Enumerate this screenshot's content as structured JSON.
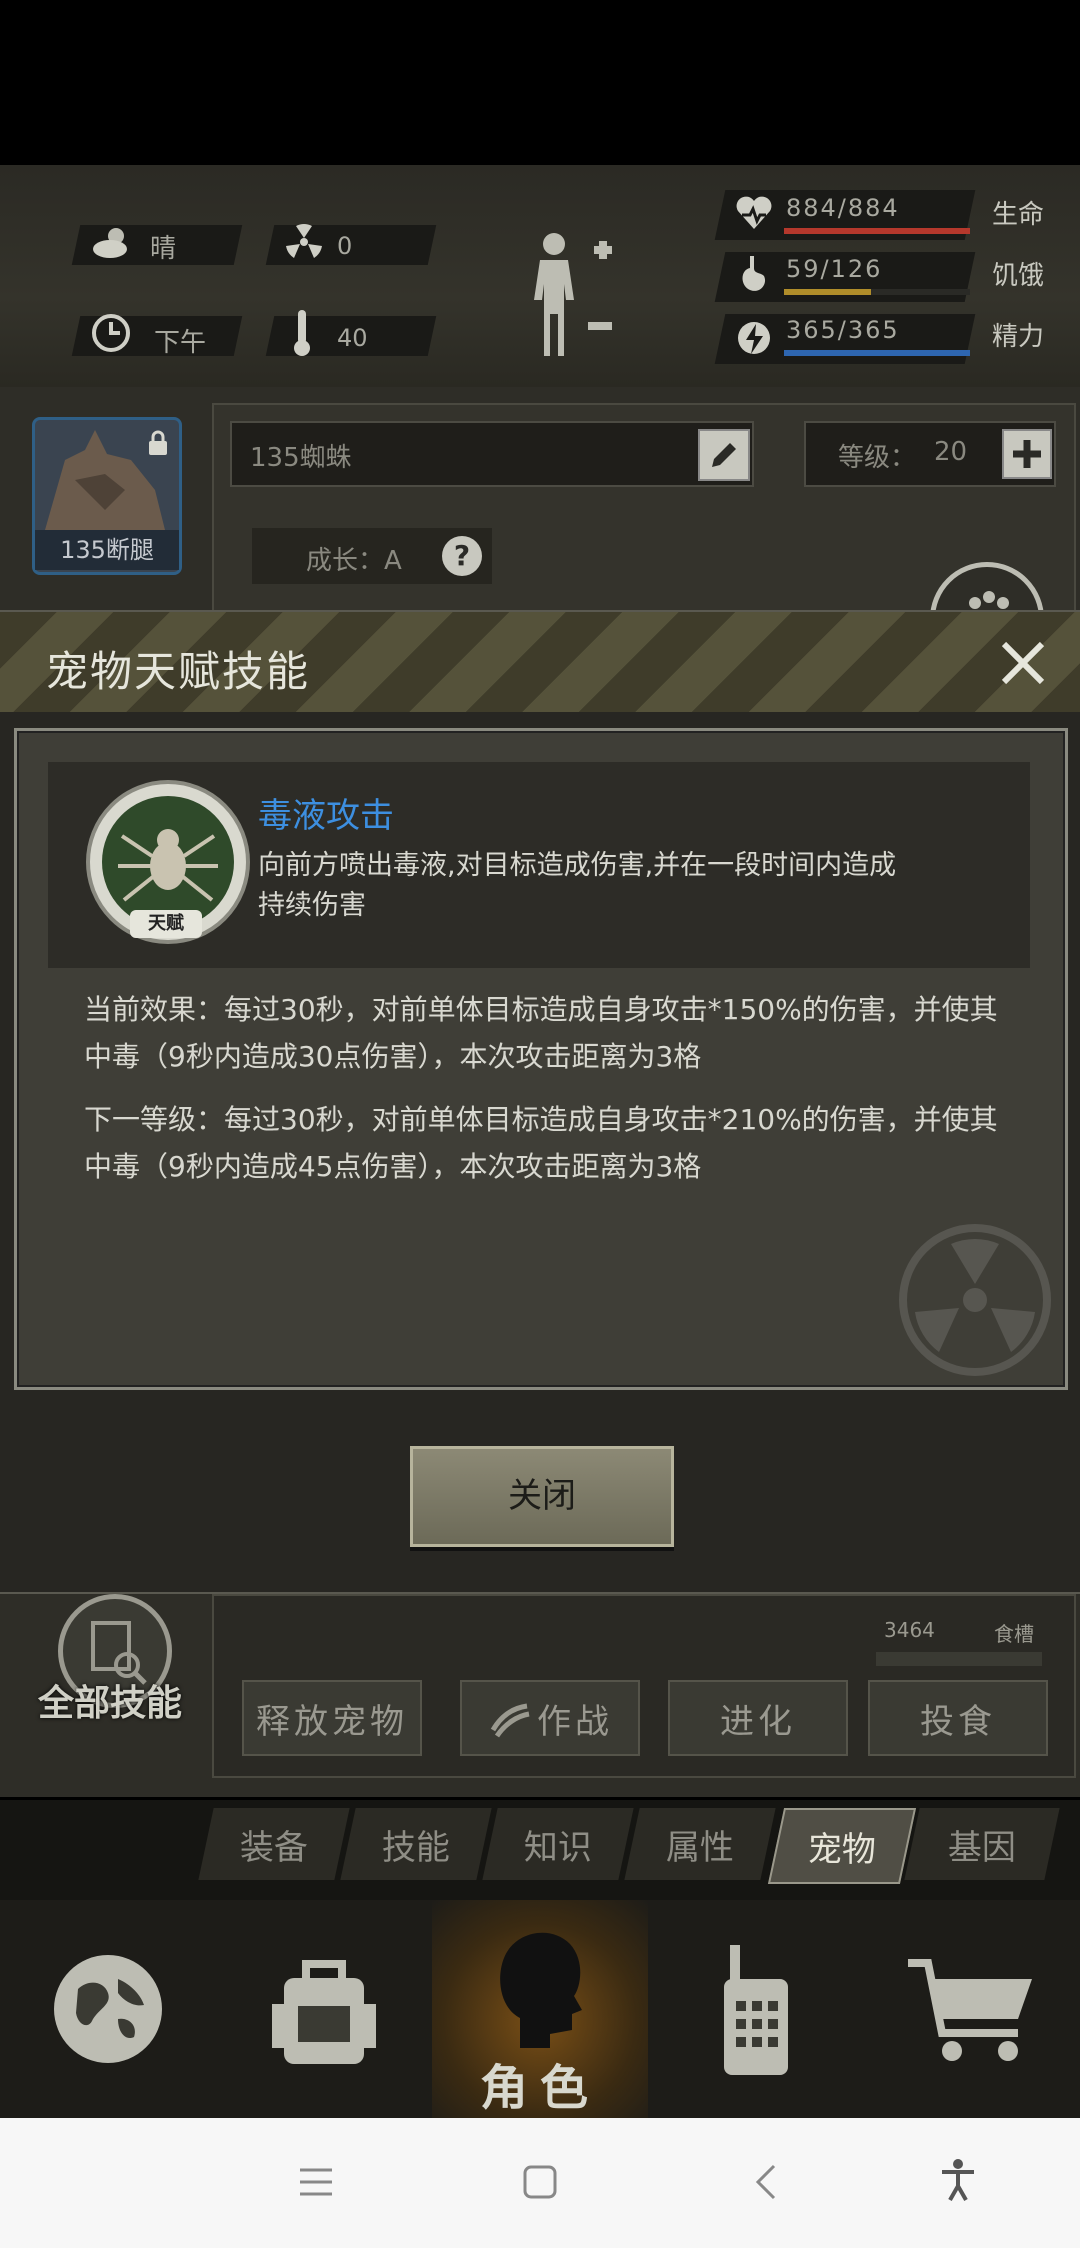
{
  "hud": {
    "weather": "晴",
    "radiation": "0",
    "time": "下午",
    "temperature": "40",
    "stats": [
      {
        "value": "884/884",
        "label": "生命",
        "fraction": 1.0,
        "color": "#b5382c"
      },
      {
        "value": "59/126",
        "label": "饥饿",
        "fraction": 0.47,
        "color": "#b08d2a"
      },
      {
        "value": "365/365",
        "label": "精力",
        "fraction": 1.0,
        "color": "#2e66b0"
      }
    ]
  },
  "pet": {
    "avatar_label": "135断腿",
    "name_value": "135蜘蛛",
    "level_label": "等级：",
    "level_value": "20",
    "growth": "成长：A"
  },
  "modal": {
    "title": "宠物天赋技能",
    "skill_name": "毒液攻击",
    "skill_badge": "天赋",
    "skill_desc_line1": "向前方喷出毒液,对目标造成伤害,并在一段时间内造成",
    "skill_desc_line2": "持续伤害",
    "current_line1": "当前效果：每过30秒，对前单体目标造成自身攻击*150%的伤害，并使其",
    "current_line2": "中毒（9秒内造成30点伤害），本次攻击距离为3格",
    "next_line1": "下一等级：每过30秒，对前单体目标造成自身攻击*210%的伤害，并使其",
    "next_line2": "中毒（9秒内造成45点伤害），本次攻击距离为3格",
    "close_label": "关闭"
  },
  "lower": {
    "all_skills": "全部技能",
    "food_value": "3464",
    "food_label": "食槽",
    "buttons": [
      "释放宠物",
      "作战",
      "进化",
      "投食"
    ]
  },
  "tabs": [
    "装备",
    "技能",
    "知识",
    "属性",
    "宠物",
    "基因"
  ],
  "active_tab": "宠物",
  "bottom_nav": {
    "role_label": "角色"
  },
  "icons": {
    "weather": "sun-cloud-icon",
    "radiation": "radiation-icon",
    "clock": "clock-icon",
    "thermometer": "thermometer-icon",
    "heart": "heart-icon",
    "stomach": "stomach-icon",
    "energy": "energy-icon"
  }
}
